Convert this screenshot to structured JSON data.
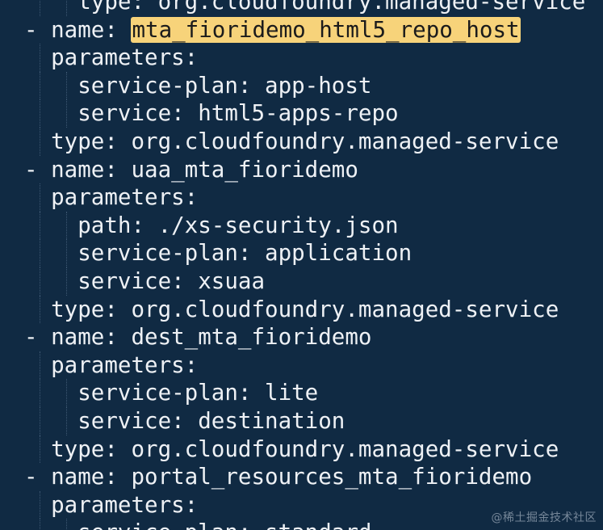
{
  "editor": {
    "lines": [
      {
        "indent": 2,
        "text": "type: org.cloudfoundry.managed-service"
      },
      {
        "indent": 0,
        "prefix": "- name: ",
        "value": "mta_fioridemo_html5_repo_host",
        "highlight": true
      },
      {
        "indent": 1,
        "text": "parameters:"
      },
      {
        "indent": 2,
        "text": "service-plan: app-host"
      },
      {
        "indent": 2,
        "text": "service: html5-apps-repo"
      },
      {
        "indent": 1,
        "text": "type: org.cloudfoundry.managed-service"
      },
      {
        "indent": 0,
        "prefix": "- name: ",
        "value": "uaa_mta_fioridemo"
      },
      {
        "indent": 1,
        "text": "parameters:"
      },
      {
        "indent": 2,
        "text": "path: ./xs-security.json"
      },
      {
        "indent": 2,
        "text": "service-plan: application"
      },
      {
        "indent": 2,
        "text": "service: xsuaa"
      },
      {
        "indent": 1,
        "text": "type: org.cloudfoundry.managed-service"
      },
      {
        "indent": 0,
        "prefix": "- name: ",
        "value": "dest_mta_fioridemo"
      },
      {
        "indent": 1,
        "text": "parameters:"
      },
      {
        "indent": 2,
        "text": "service-plan: lite"
      },
      {
        "indent": 2,
        "text": "service: destination"
      },
      {
        "indent": 1,
        "text": "type: org.cloudfoundry.managed-service"
      },
      {
        "indent": 0,
        "prefix": "- name: ",
        "value": "portal_resources_mta_fioridemo"
      },
      {
        "indent": 1,
        "text": "parameters:"
      },
      {
        "indent": 2,
        "text": "service-plan: standard"
      }
    ]
  },
  "watermark": "@稀土掘金技术社区",
  "colors": {
    "background": "#102a43",
    "text": "#eef1f5",
    "highlight": "#f7d37a"
  }
}
